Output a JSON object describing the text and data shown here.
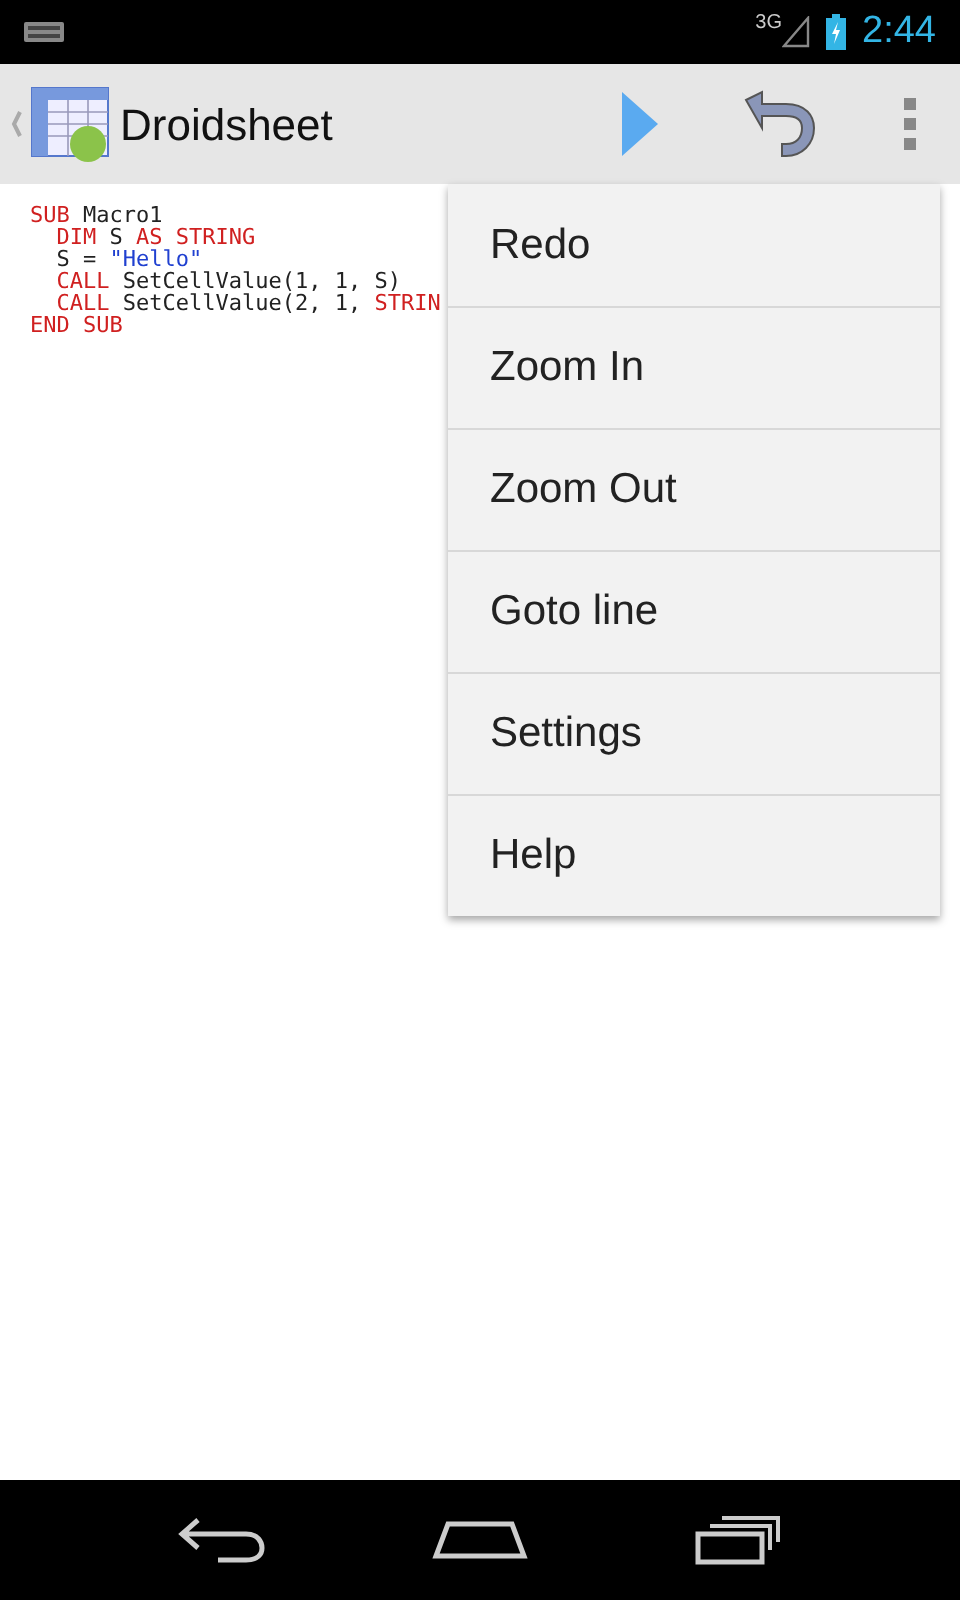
{
  "status_bar": {
    "time": "2:44",
    "network": "3G"
  },
  "action_bar": {
    "title": "Droidsheet"
  },
  "code_lines": [
    [
      {
        "text": "SUB",
        "kind": "keyword"
      },
      {
        "text": " Macro1",
        "kind": "plain"
      }
    ],
    [
      {
        "text": "  DIM",
        "kind": "keyword"
      },
      {
        "text": " S ",
        "kind": "plain"
      },
      {
        "text": "AS STRING",
        "kind": "keyword"
      }
    ],
    [
      {
        "text": "  S = ",
        "kind": "plain"
      },
      {
        "text": "\"Hello\"",
        "kind": "string"
      }
    ],
    [
      {
        "text": "  CALL",
        "kind": "keyword"
      },
      {
        "text": " SetCellValue(1, 1, S)",
        "kind": "plain"
      }
    ],
    [
      {
        "text": "  CALL",
        "kind": "keyword"
      },
      {
        "text": " SetCellValue(2, 1, ",
        "kind": "plain"
      },
      {
        "text": "STRIN",
        "kind": "keyword"
      }
    ],
    [
      {
        "text": "END SUB",
        "kind": "keyword"
      }
    ]
  ],
  "menu": [
    {
      "label": "Redo"
    },
    {
      "label": "Zoom In"
    },
    {
      "label": "Zoom Out"
    },
    {
      "label": "Goto line"
    },
    {
      "label": "Settings"
    },
    {
      "label": "Help"
    }
  ]
}
